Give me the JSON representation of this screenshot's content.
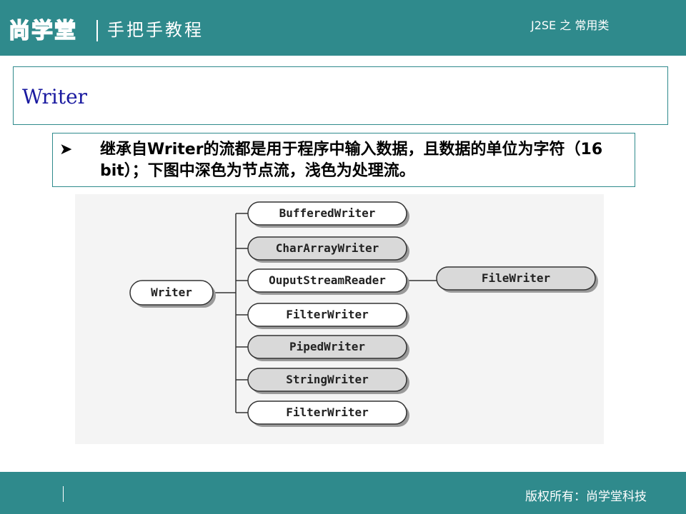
{
  "header": {
    "logo": "尚学堂",
    "tagline": "手把手教程",
    "course": "J2SE 之 常用类"
  },
  "slide": {
    "title": "Writer",
    "bullet_icon": "arrow-bullet-icon",
    "bullet_text": "继承自Writer的流都是用于程序中输入数据，且数据的单位为字符（16 bit）；下图中深色为节点流，浅色为处理流。"
  },
  "diagram": {
    "root": "Writer",
    "children": [
      {
        "label": "BufferedWriter",
        "kind": "light"
      },
      {
        "label": "CharArrayWriter",
        "kind": "dark"
      },
      {
        "label": "OuputStreamReader",
        "kind": "light"
      },
      {
        "label": "FilterWriter",
        "kind": "light"
      },
      {
        "label": "PipedWriter",
        "kind": "dark"
      },
      {
        "label": "StringWriter",
        "kind": "dark"
      },
      {
        "label": "FilterWriter",
        "kind": "light"
      }
    ],
    "sub": {
      "parent_index": 2,
      "label": "FileWriter",
      "kind": "dark"
    },
    "colors": {
      "light": "#ffffff",
      "dark": "#d9d9d9",
      "shadow": "#9a9a9a",
      "line": "#333333"
    }
  },
  "footer": {
    "copyright": "版权所有：尚学堂科技"
  }
}
